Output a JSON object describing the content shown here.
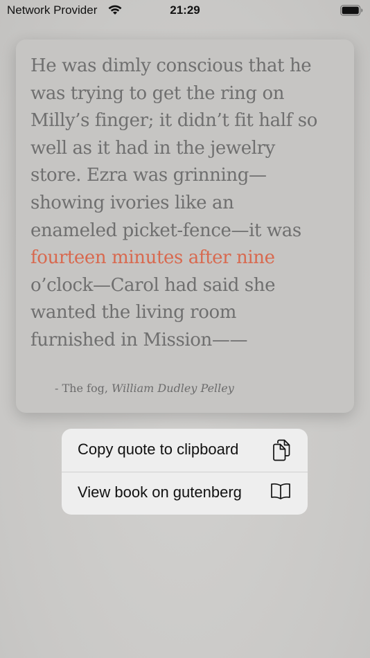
{
  "status_bar": {
    "carrier": "Network Provider",
    "time": "21:29"
  },
  "quote": {
    "lines_before": [
      "He was dimly conscious that he",
      "was trying to get the ring on",
      "Milly’s finger; it didn’t fit half so",
      "well as it had in the jewelry",
      "store. Ezra was grinning—",
      "showing ivories like an",
      "enameled picket-fence—it was"
    ],
    "highlight": "fourteen minutes after nine",
    "lines_after": [
      "o’clock—Carol had said she",
      "wanted the living room",
      "furnished in Mission——"
    ],
    "accent_color": "#d8694f",
    "attribution_prefix": "- The fog, ",
    "author": "William Dudley Pelley"
  },
  "menu": {
    "items": [
      {
        "label": "Copy quote to clipboard",
        "icon": "copy-icon"
      },
      {
        "label": "View book on gutenberg",
        "icon": "book-icon"
      }
    ]
  }
}
